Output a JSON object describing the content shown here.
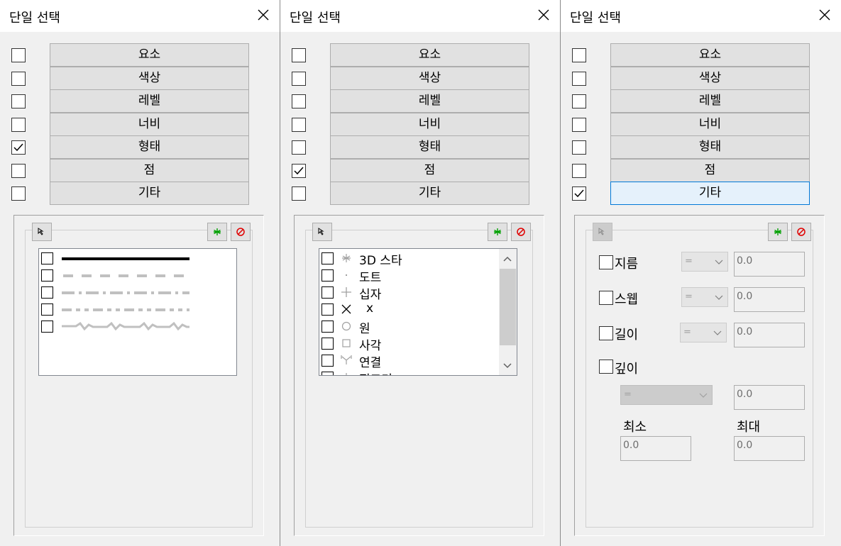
{
  "title": "단일 선택",
  "criteria": [
    "요소",
    "색상",
    "레벨",
    "너비",
    "형태",
    "점",
    "기타"
  ],
  "panels": [
    {
      "checked_index": 4
    },
    {
      "checked_index": 5
    },
    {
      "checked_index": 6,
      "focused_index": 6
    }
  ],
  "style_list": {
    "items": [
      "solid-line",
      "dashed-line",
      "dash-dot-line",
      "dash-dot-dot-line",
      "wavy-line"
    ]
  },
  "point_list": {
    "items": [
      {
        "icon": "asterisk-icon",
        "label": "3D 스타"
      },
      {
        "icon": "dot-icon",
        "label": "도트"
      },
      {
        "icon": "plus-icon",
        "label": "십자"
      },
      {
        "icon": "x-icon",
        "label": "x"
      },
      {
        "icon": "circle-icon",
        "label": "원"
      },
      {
        "icon": "square-icon",
        "label": "사각"
      },
      {
        "icon": "connect-icon",
        "label": "연결"
      },
      {
        "icon": "partial-icon",
        "label": "직교기"
      }
    ]
  },
  "other": {
    "fields": [
      {
        "label": "지름",
        "op": "=",
        "value": "0.0"
      },
      {
        "label": "스웹",
        "op": "=",
        "value": "0.0"
      },
      {
        "label": "길이",
        "op": "=",
        "value": "0.0"
      }
    ],
    "depth": {
      "label": "깊이",
      "op": "=",
      "value": "0.0"
    },
    "min_label": "최소",
    "max_label": "최대",
    "min_value": "0.0",
    "max_value": "0.0"
  },
  "colors": {
    "accent": "#0078d7",
    "green": "#00a000",
    "red": "#e00000"
  }
}
